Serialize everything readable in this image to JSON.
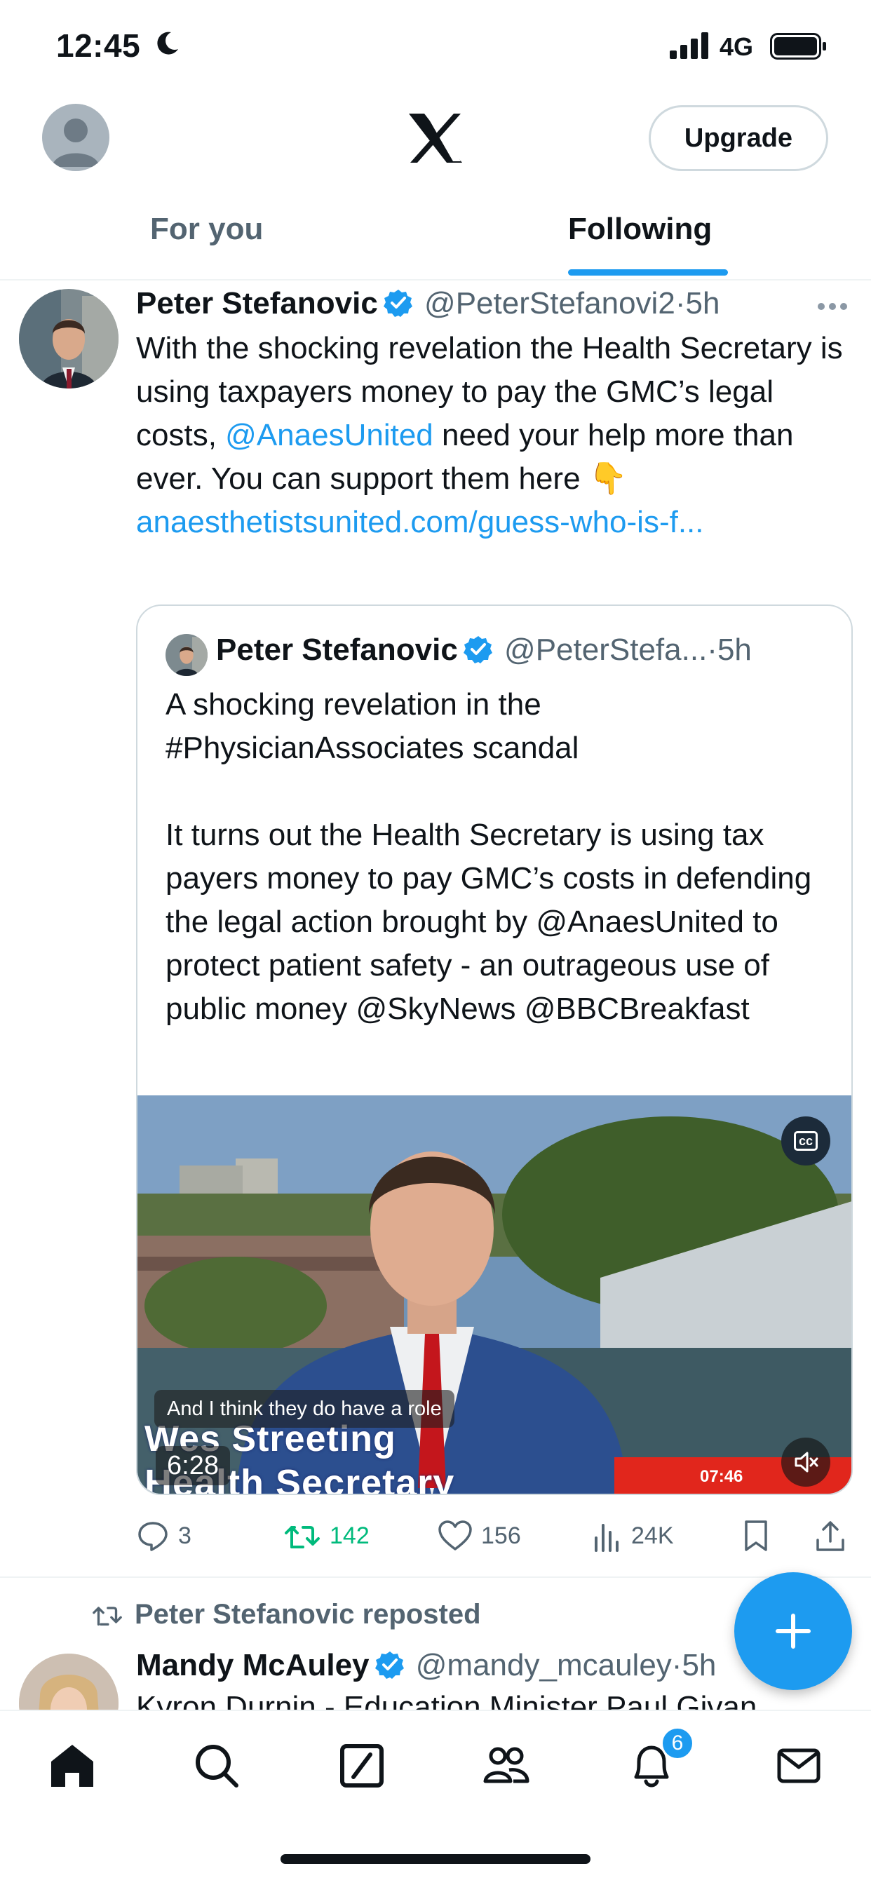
{
  "status_bar": {
    "time": "12:45",
    "network": "4G"
  },
  "header": {
    "upgrade_label": "Upgrade",
    "tabs": [
      {
        "label": "For you",
        "active": false
      },
      {
        "label": "Following",
        "active": true
      }
    ]
  },
  "tweet": {
    "author_name": "Peter Stefanovic",
    "handle": "@PeterStefanovi2",
    "dot": "·",
    "time": "5h",
    "text_part1": "With the shocking revelation the Health Secretary is using taxpayers money to pay the GMC’s legal costs, ",
    "mention": "@AnaesUnited",
    "text_part2": " need your help more than ever. You can support them here 👇",
    "link": "anaesthetistsunited.com/guess-who-is-f...",
    "quote": {
      "author_name": "Peter Stefanovic",
      "handle": "@PeterStefa...",
      "dot": "·",
      "time": "5h",
      "text": "A shocking revelation in the #PhysicianAssociates scandal\n\nIt turns out the Health Secretary is using tax payers money to pay GMC’s costs in defending the legal action brought by @AnaesUnited to protect patient safety  - an outrageous use of public money @SkyNews @BBCBreakfast",
      "video": {
        "subtitle": "And I think they do have a role",
        "lower_third_name": "Wes Streeting",
        "lower_third_role": "Health Secretary",
        "duration": "6:28",
        "clock": "07:46"
      }
    },
    "stats": {
      "replies": "3",
      "reposts": "142",
      "likes": "156",
      "views": "24K"
    }
  },
  "second_tweet": {
    "repost_label": "Peter Stefanovic reposted",
    "author_name": "Mandy McAuley",
    "handle": "@mandy_mcauley",
    "dot": "·",
    "time": "5h",
    "text": "Kyron Durnin - Education Minister Paul Givan..."
  },
  "nav": {
    "notification_count": "6"
  },
  "colors": {
    "accent": "#1d9bf0",
    "repost": "#00ba7c",
    "secondary_text": "#536471"
  },
  "icons": [
    "home-icon",
    "search-icon",
    "grok-icon",
    "communities-icon",
    "notifications-icon",
    "messages-icon",
    "compose-plus-icon",
    "verified-badge-icon"
  ]
}
